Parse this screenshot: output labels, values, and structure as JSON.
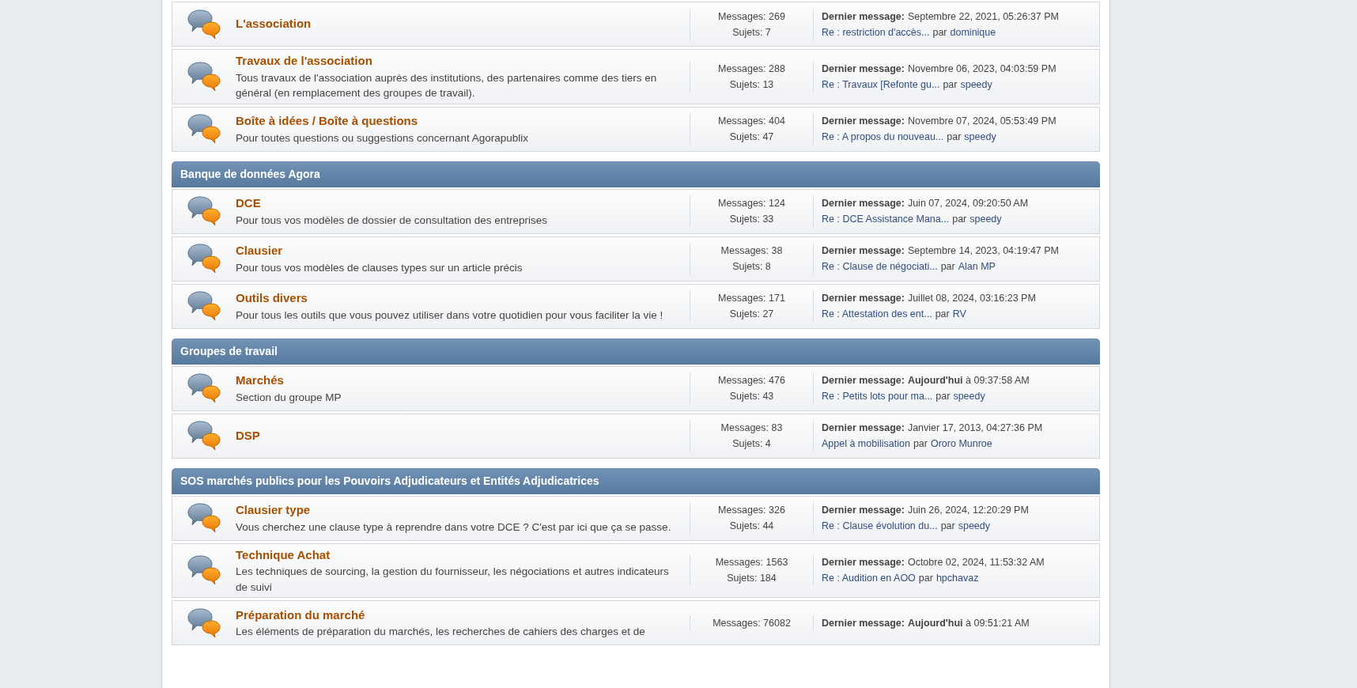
{
  "sections": [
    {
      "forums": [
        {
          "name": "L'association",
          "messages": "Messages: 269",
          "topics": "Sujets: 7",
          "last_label": "Dernier message:",
          "last_date": "Septembre 22, 2021, 05:26:37 PM",
          "last_topic": "Re : restriction d'accès...",
          "by": "par",
          "author": "dominique"
        },
        {
          "name": "Travaux de l'association",
          "description": "Tous travaux de l'association auprès des institutions, des partenaires comme des tiers en général (en remplacement des groupes de travail).",
          "messages": "Messages: 288",
          "topics": "Sujets: 13",
          "last_label": "Dernier message:",
          "last_date": "Novembre 06, 2023, 04:03:59 PM",
          "last_topic": "Re : Travaux [Refonte gu...",
          "by": "par",
          "author": "speedy"
        },
        {
          "name": "Boîte à idées / Boîte à questions",
          "description": "Pour toutes questions ou suggestions concernant Agorapublix",
          "messages": "Messages: 404",
          "topics": "Sujets: 47",
          "last_label": "Dernier message:",
          "last_date": "Novembre 07, 2024, 05:53:49 PM",
          "last_topic": "Re : A propos du nouveau...",
          "by": "par",
          "author": "speedy"
        }
      ]
    },
    {
      "title": "Banque de données Agora",
      "forums": [
        {
          "name": "DCE",
          "description": "Pour tous vos modèles de dossier de consultation des entreprises",
          "messages": "Messages: 124",
          "topics": "Sujets: 33",
          "last_label": "Dernier message:",
          "last_date": "Juin 07, 2024, 09:20:50 AM",
          "last_topic": "Re : DCE Assistance Mana...",
          "by": "par",
          "author": "speedy"
        },
        {
          "name": "Clausier",
          "description": "Pour tous vos modèles de clauses types sur un article précis",
          "messages": "Messages: 38",
          "topics": "Sujets: 8",
          "last_label": "Dernier message:",
          "last_date": "Septembre 14, 2023, 04:19:47 PM",
          "last_topic": "Re : Clause de négociati...",
          "by": "par",
          "author": "Alan MP"
        },
        {
          "name": "Outils divers",
          "description": "Pour tous les outils que vous pouvez utiliser dans votre quotidien pour vous faciliter la vie !",
          "messages": "Messages: 171",
          "topics": "Sujets: 27",
          "last_label": "Dernier message:",
          "last_date": "Juillet 08, 2024, 03:16:23 PM",
          "last_topic": "Re : Attestation des ent...",
          "by": "par",
          "author": "RV"
        }
      ]
    },
    {
      "title": "Groupes de travail",
      "forums": [
        {
          "name": "Marchés",
          "description": "Section du groupe MP",
          "messages": "Messages: 476",
          "topics": "Sujets: 43",
          "last_label": "Dernier message:",
          "last_date": "**Aujourd'hui** à 09:37:58 AM",
          "last_topic": "Re : Petits lots pour ma...",
          "by": "par",
          "author": "speedy"
        },
        {
          "name": "DSP",
          "messages": "Messages: 83",
          "topics": "Sujets: 4",
          "last_label": "Dernier message:",
          "last_date": "Janvier 17, 2013, 04:27:36 PM",
          "last_topic": "Appel à mobilisation",
          "by": "par",
          "author": "Ororo Munroe"
        }
      ]
    },
    {
      "title": "SOS marchés publics pour les Pouvoirs Adjudicateurs et Entités Adjudicatrices",
      "forums": [
        {
          "name": "Clausier type",
          "description": "Vous cherchez une clause type à reprendre dans votre DCE ? C'est par ici que ça se passe.",
          "messages": "Messages: 326",
          "topics": "Sujets: 44",
          "last_label": "Dernier message:",
          "last_date": "Juin 26, 2024, 12:20:29 PM",
          "last_topic": "Re : Clause évolution du...",
          "by": "par",
          "author": "speedy"
        },
        {
          "name": "Technique Achat",
          "description": "Les techniques de sourcing, la gestion du fournisseur, les négociations et autres indicateurs de suivi",
          "messages": "Messages: 1563",
          "topics": "Sujets: 184",
          "last_label": "Dernier message:",
          "last_date": "Octobre 02, 2024, 11:53:32 AM",
          "last_topic": "Re : Audition en AOO",
          "by": "par",
          "author": "hpchavaz"
        },
        {
          "name": "Préparation du marché",
          "description": "Les éléments de préparation du marchés, les recherches de cahiers des charges et de",
          "messages": "Messages: 76082",
          "last_label": "Dernier message:",
          "last_date": "**Aujourd'hui** à 09:51:21 AM"
        }
      ]
    }
  ]
}
